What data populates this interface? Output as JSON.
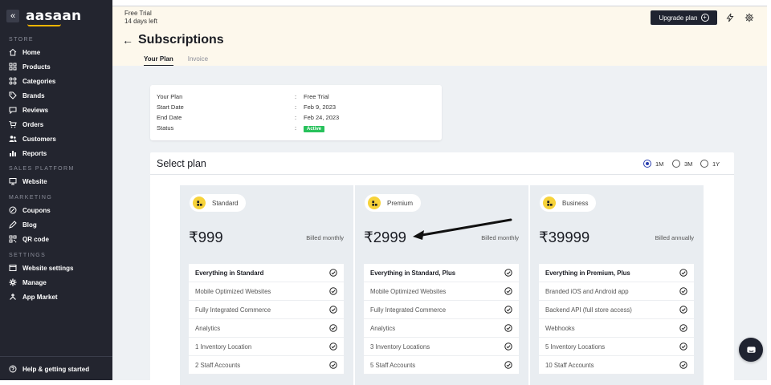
{
  "sidebar": {
    "logo": "aasaan",
    "collapse_icon": "«",
    "sections": [
      {
        "label": "STORE",
        "items": [
          {
            "label": "Home",
            "icon": "home-icon"
          },
          {
            "label": "Products",
            "icon": "grid-icon"
          },
          {
            "label": "Categories",
            "icon": "categories-icon"
          },
          {
            "label": "Brands",
            "icon": "tag-icon"
          },
          {
            "label": "Reviews",
            "icon": "comment-icon"
          },
          {
            "label": "Orders",
            "icon": "cart-icon"
          },
          {
            "label": "Customers",
            "icon": "users-icon"
          },
          {
            "label": "Reports",
            "icon": "chart-icon"
          }
        ]
      },
      {
        "label": "SALES PLATFORM",
        "items": [
          {
            "label": "Website",
            "icon": "monitor-icon"
          }
        ]
      },
      {
        "label": "MARKETING",
        "items": [
          {
            "label": "Coupons",
            "icon": "coupon-icon"
          },
          {
            "label": "Blog",
            "icon": "blog-icon"
          },
          {
            "label": "QR code",
            "icon": "qr-icon"
          }
        ]
      },
      {
        "label": "SETTINGS",
        "items": [
          {
            "label": "Website settings",
            "icon": "settings-icon"
          },
          {
            "label": "Manage",
            "icon": "gear-icon"
          },
          {
            "label": "App Market",
            "icon": "apps-icon"
          }
        ]
      }
    ],
    "help": {
      "label": "Help & getting started",
      "icon": "help-icon"
    }
  },
  "topbar": {
    "trial_line1": "Free Trial",
    "trial_line2": "14 days left",
    "upgrade_label": "Upgrade plan",
    "title": "Subscriptions",
    "tabs": [
      {
        "label": "Your Plan",
        "active": true
      },
      {
        "label": "Invoice",
        "active": false
      }
    ]
  },
  "current_plan": {
    "rows": [
      {
        "key": "Your Plan",
        "value": "Free Trial"
      },
      {
        "key": "Start Date",
        "value": "Feb 9, 2023"
      },
      {
        "key": "End Date",
        "value": "Feb 24, 2023"
      },
      {
        "key": "Status",
        "value": "Active"
      }
    ],
    "separator": ":"
  },
  "select_plan": {
    "title": "Select plan",
    "periods": [
      {
        "label": "1M",
        "selected": true
      },
      {
        "label": "3M",
        "selected": false
      },
      {
        "label": "1Y",
        "selected": false
      }
    ],
    "plans": [
      {
        "name": "Standard",
        "price": "₹999",
        "billing": "Billed monthly",
        "features": [
          "Everything in Standard",
          "Mobile Optimized Websites",
          "Fully Integrated Commerce",
          "Analytics",
          "1 Inventory Location",
          "2 Staff Accounts"
        ]
      },
      {
        "name": "Premium",
        "price": "₹2999",
        "billing": "Billed monthly",
        "features": [
          "Everything in Standard, Plus",
          "Mobile Optimized Websites",
          "Fully Integrated Commerce",
          "Analytics",
          "3 Inventory Locations",
          "5 Staff Accounts"
        ]
      },
      {
        "name": "Business",
        "price": "₹39999",
        "billing": "Billed annually",
        "features": [
          "Everything in Premium, Plus",
          "Branded iOS and Android app",
          "Backend API (full store access)",
          "Webhooks",
          "5 Inventory Locations",
          "10 Staff Accounts"
        ]
      }
    ]
  },
  "colors": {
    "sidebar": "#23252f",
    "topbar": "#fdf8ec",
    "accent": "#f7d33a",
    "active_badge": "#27c15b",
    "radio": "#2a3fb0"
  }
}
